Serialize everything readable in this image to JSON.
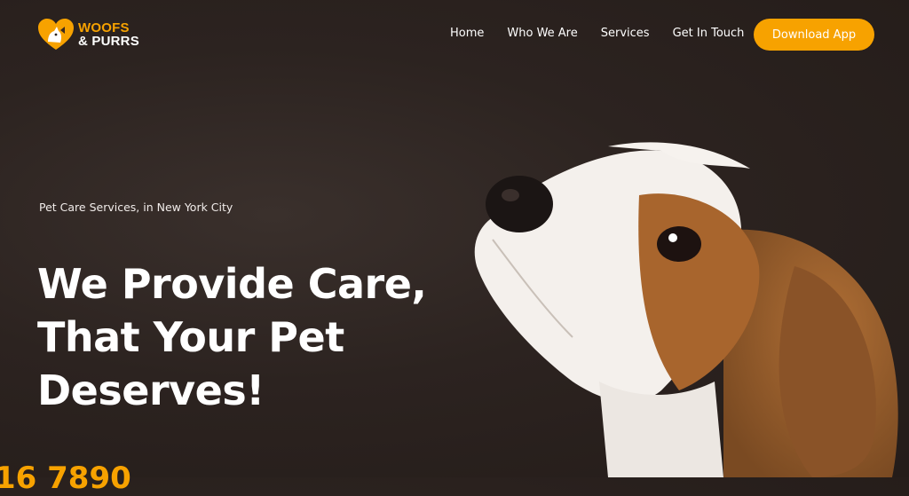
{
  "brand": {
    "line1": "WOOFS",
    "line2": "& PURRS",
    "accent": "#f7a200"
  },
  "nav": {
    "items": [
      {
        "label": "Home"
      },
      {
        "label": "Who We Are"
      },
      {
        "label": "Services"
      },
      {
        "label": "Get In Touch"
      }
    ],
    "cta_label": "Download App"
  },
  "hero": {
    "eyebrow": "Pet Care Services, in New York City",
    "title_lines": [
      "We Provide Care,",
      "That Your Pet",
      "Deserves!"
    ],
    "partial_number": "16 7890"
  },
  "icons": {
    "logo": "heart-paw-logo-icon"
  },
  "colors": {
    "background": "#2c2320",
    "accent": "#f7a200",
    "text": "#ffffff"
  }
}
